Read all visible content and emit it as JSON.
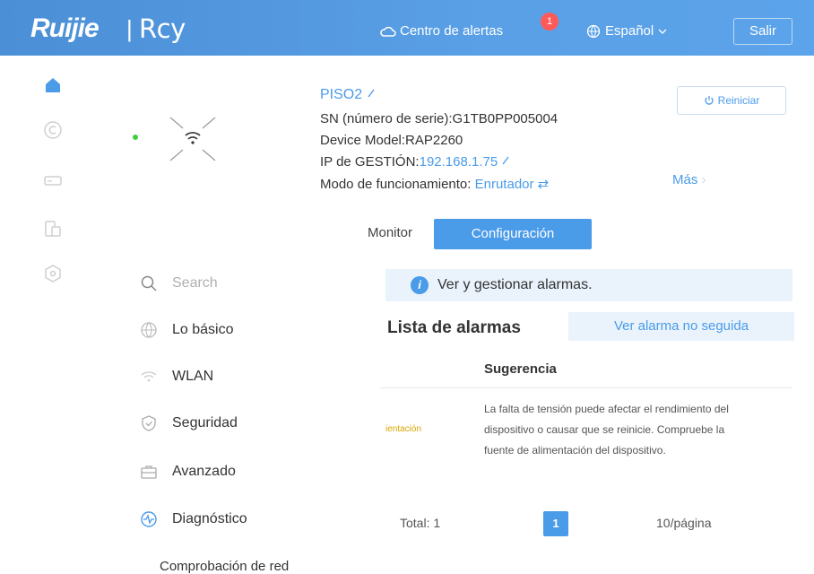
{
  "header": {
    "logo": "Ruijie",
    "logo_separator": "|",
    "logo_sub": "Rcy",
    "alarm_center": "Centro de alertas",
    "alarm_badge": "1",
    "language": "Español",
    "logout": "Salir"
  },
  "device": {
    "name": "PISO2",
    "serial": "SN (número de serie):G1TB0PP005004",
    "model": "Device Model:RAP2260",
    "ip_label": "IP de GESTIÓN:",
    "ip_value": "192.168.1.75",
    "mode_label": "Modo de funcionamiento:",
    "mode_value": "Enrutador",
    "more": "Más",
    "reboot": "Reiniciar"
  },
  "tabs": {
    "monitor": "Monitor",
    "config": "Configuración"
  },
  "menu": {
    "search_placeholder": "Search",
    "items": [
      {
        "label": "Lo básico"
      },
      {
        "label": "WLAN"
      },
      {
        "label": "Seguridad"
      },
      {
        "label": "Avanzado"
      },
      {
        "label": "Diagnóstico"
      }
    ],
    "sub_item": "Comprobación de red"
  },
  "alarms": {
    "info": "Ver y gestionar alarmas.",
    "title": "Lista de alarmas",
    "unfollowed_button": "Ver alarma no seguida",
    "column_suggestion": "Sugerencia",
    "row_type": "ientación",
    "row_suggestion": "La falta de tensión puede afectar el rendimiento del dispositivo o causar que se reinicie. Compruebe la fuente de alimentación del dispositivo.",
    "total": "Total: 1",
    "current_page": "1",
    "per_page": "10/página"
  },
  "colors": {
    "primary": "#4a9be8",
    "header": "#4b8fd6",
    "badge": "#ff5a5a",
    "status_online": "#3ecf3e"
  }
}
